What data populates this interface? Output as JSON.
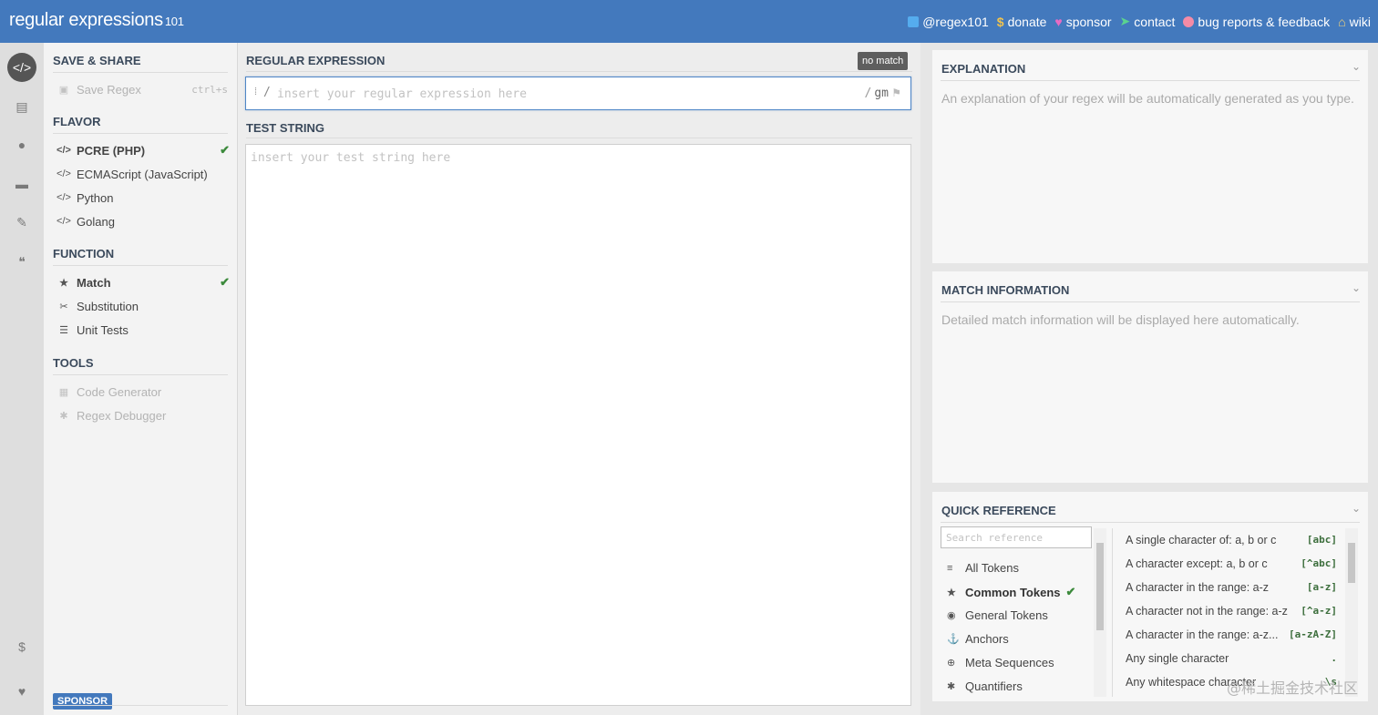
{
  "app": {
    "title": "regular expressions",
    "version": "101"
  },
  "topnav": [
    {
      "label": "@regex101",
      "icon": "twitter-icon",
      "color": "#55acee"
    },
    {
      "label": "donate",
      "icon": "dollar-icon",
      "color": "#f0c34e"
    },
    {
      "label": "sponsor",
      "icon": "heart-icon",
      "color": "#e76bc3"
    },
    {
      "label": "contact",
      "icon": "paper-plane-icon",
      "color": "#5bd38f"
    },
    {
      "label": "bug reports & feedback",
      "icon": "bug-icon",
      "color": "#f58ba6"
    },
    {
      "label": "wiki",
      "icon": "bank-icon",
      "color": "#f0d27a"
    }
  ],
  "sidebar": {
    "save_share": {
      "heading": "SAVE & SHARE",
      "save_label": "Save Regex",
      "save_shortcut": "ctrl+s"
    },
    "flavor": {
      "heading": "FLAVOR",
      "items": [
        {
          "label": "PCRE (PHP)",
          "selected": true
        },
        {
          "label": "ECMAScript (JavaScript)"
        },
        {
          "label": "Python"
        },
        {
          "label": "Golang"
        }
      ]
    },
    "function": {
      "heading": "FUNCTION",
      "items": [
        {
          "label": "Match",
          "selected": true
        },
        {
          "label": "Substitution"
        },
        {
          "label": "Unit Tests"
        }
      ]
    },
    "tools": {
      "heading": "TOOLS",
      "items": [
        {
          "label": "Code Generator"
        },
        {
          "label": "Regex Debugger"
        }
      ]
    },
    "sponsor_label": "SPONSOR"
  },
  "editor": {
    "regex_heading": "REGULAR EXPRESSION",
    "status": "no match",
    "regex_placeholder": "insert your regular expression here",
    "regex_delim": "/",
    "flags": "gm",
    "test_heading": "TEST STRING",
    "test_placeholder": "insert your test string here"
  },
  "explanation": {
    "heading": "EXPLANATION",
    "text": "An explanation of your regex will be automatically generated as you type."
  },
  "match_info": {
    "heading": "MATCH INFORMATION",
    "text": "Detailed match information will be displayed here automatically."
  },
  "quick_ref": {
    "heading": "QUICK REFERENCE",
    "search_placeholder": "Search reference",
    "categories": [
      {
        "label": "All Tokens",
        "icon": "database-icon"
      },
      {
        "label": "Common Tokens",
        "icon": "star-icon",
        "selected": true
      },
      {
        "label": "General Tokens",
        "icon": "target-icon"
      },
      {
        "label": "Anchors",
        "icon": "anchor-icon"
      },
      {
        "label": "Meta Sequences",
        "icon": "lifebuoy-icon"
      },
      {
        "label": "Quantifiers",
        "icon": "asterisk-icon"
      }
    ],
    "tokens": [
      {
        "desc": "A single character of: a, b or c",
        "token": "[abc]"
      },
      {
        "desc": "A character except: a, b or c",
        "token": "[^abc]"
      },
      {
        "desc": "A character in the range: a-z",
        "token": "[a-z]"
      },
      {
        "desc": "A character not in the range: a-z",
        "token": "[^a-z]"
      },
      {
        "desc": "A character in the range: a-z...",
        "token": "[a-zA-Z]"
      },
      {
        "desc": "Any single character",
        "token": "."
      },
      {
        "desc": "Any whitespace character",
        "token": "\\s"
      }
    ]
  },
  "watermark": "@稀土掘金技术社区"
}
